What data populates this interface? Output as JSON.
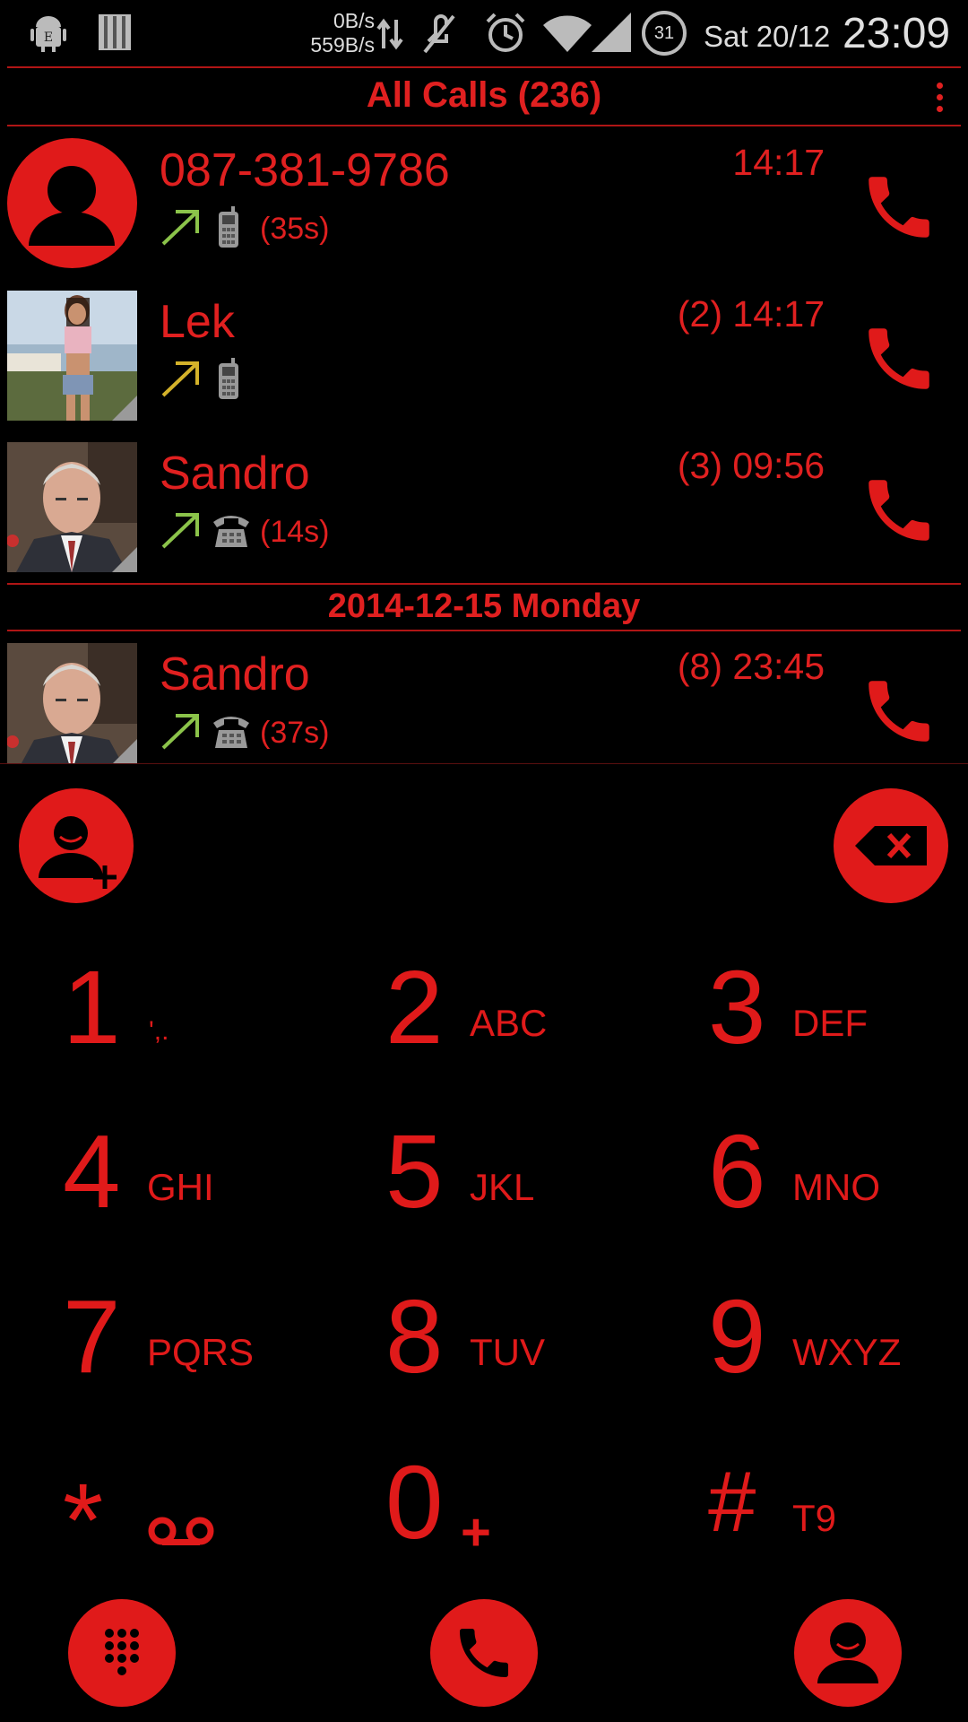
{
  "status_bar": {
    "speed_down": "0B/s",
    "speed_up": "559B/s",
    "battery_level": "31",
    "date": "Sat 20/12",
    "time": "23:09"
  },
  "header": {
    "title": "All Calls (236)"
  },
  "calls": [
    {
      "name": "087-381-9786",
      "time": "14:17",
      "duration": "(35s)",
      "direction": "outgoing",
      "direction_color": "#8bc34a",
      "device": "mobile"
    },
    {
      "name": "Lek",
      "time": "(2) 14:17",
      "duration": "",
      "direction": "outgoing",
      "direction_color": "#d4b22a",
      "device": "mobile"
    },
    {
      "name": "Sandro",
      "time": "(3) 09:56",
      "duration": "(14s)",
      "direction": "outgoing",
      "direction_color": "#8bc34a",
      "device": "landline"
    }
  ],
  "date_separator": "2014-12-15  Monday",
  "calls_older": [
    {
      "name": "Sandro",
      "time": "(8) 23:45",
      "duration": "(37s)",
      "direction": "outgoing",
      "direction_color": "#8bc34a",
      "device": "landline"
    }
  ],
  "dialpad": {
    "keys": [
      {
        "digit": "1",
        "letters": "',."
      },
      {
        "digit": "2",
        "letters": "ABC"
      },
      {
        "digit": "3",
        "letters": "DEF"
      },
      {
        "digit": "4",
        "letters": "GHI"
      },
      {
        "digit": "5",
        "letters": "JKL"
      },
      {
        "digit": "6",
        "letters": "MNO"
      },
      {
        "digit": "7",
        "letters": "PQRS"
      },
      {
        "digit": "8",
        "letters": "TUV"
      },
      {
        "digit": "9",
        "letters": "WXYZ"
      },
      {
        "digit": "*",
        "letters": ""
      },
      {
        "digit": "0",
        "letters": "+"
      },
      {
        "digit": "#",
        "letters": "T9"
      }
    ]
  },
  "colors": {
    "accent": "#e01a1a",
    "background": "#000000",
    "outgoing_answered": "#8bc34a",
    "outgoing_unanswered": "#d4b22a"
  },
  "icons": {
    "add_contact": "add-contact-icon",
    "backspace": "backspace-icon",
    "dialpad_toggle": "dialpad-icon",
    "call": "phone-icon",
    "contacts": "contacts-icon",
    "voicemail": "voicemail-icon"
  }
}
